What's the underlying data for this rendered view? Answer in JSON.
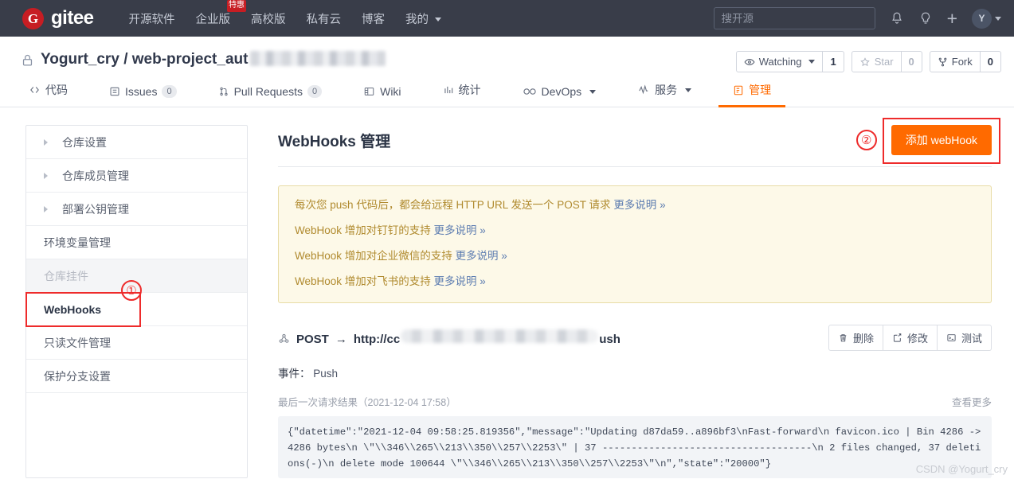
{
  "topnav": {
    "brand": {
      "logo_glyph": "G",
      "name": "gitee"
    },
    "links": [
      {
        "label": "开源软件",
        "badge": ""
      },
      {
        "label": "企业版",
        "badge": "特惠"
      },
      {
        "label": "高校版",
        "badge": ""
      },
      {
        "label": "私有云",
        "badge": ""
      },
      {
        "label": "博客",
        "badge": ""
      },
      {
        "label": "我的",
        "badge": "",
        "has_caret": true
      }
    ],
    "search_placeholder": "搜开源",
    "icons": [
      "bell-icon",
      "lightbulb-icon",
      "plus-icon"
    ],
    "avatar_initial": "Y"
  },
  "repo": {
    "owner": "Yogurt_cry",
    "separator": "/",
    "name_visible": "web-project_aut",
    "watch_label": "Watching",
    "watch_count": "1",
    "star_label": "Star",
    "star_count": "0",
    "fork_label": "Fork",
    "fork_count": "0"
  },
  "tabs": [
    {
      "label": "代码",
      "icon": "code-icon",
      "count": "",
      "active": false
    },
    {
      "label": "Issues",
      "icon": "issue-icon",
      "count": "0",
      "active": false
    },
    {
      "label": "Pull Requests",
      "icon": "pull-request-icon",
      "count": "0",
      "active": false
    },
    {
      "label": "Wiki",
      "icon": "wiki-icon",
      "count": "",
      "active": false
    },
    {
      "label": "统计",
      "icon": "chart-icon",
      "count": "",
      "active": false
    },
    {
      "label": "DevOps",
      "icon": "infinity-icon",
      "count": "",
      "active": false,
      "caret": true
    },
    {
      "label": "服务",
      "icon": "pulse-icon",
      "count": "",
      "active": false,
      "caret": true
    },
    {
      "label": "管理",
      "icon": "manage-icon",
      "count": "",
      "active": true
    }
  ],
  "sidebar": {
    "items": [
      {
        "label": "仓库设置",
        "expandable": true,
        "state": "normal"
      },
      {
        "label": "仓库成员管理",
        "expandable": true,
        "state": "normal"
      },
      {
        "label": "部署公钥管理",
        "expandable": true,
        "state": "normal"
      },
      {
        "label": "环境变量管理",
        "expandable": false,
        "state": "normal"
      },
      {
        "label": "仓库挂件",
        "expandable": false,
        "state": "muted"
      },
      {
        "label": "WebHooks",
        "expandable": false,
        "state": "selected"
      },
      {
        "label": "只读文件管理",
        "expandable": false,
        "state": "normal"
      },
      {
        "label": "保护分支设置",
        "expandable": false,
        "state": "normal"
      }
    ]
  },
  "markers": {
    "one": "①",
    "two": "②"
  },
  "main": {
    "title": "WebHooks 管理",
    "add_button": "添加 webHook",
    "notice": [
      {
        "text": "每次您 push 代码后，都会给远程 HTTP URL 发送一个 POST 请求 ",
        "link": "更多说明 »"
      },
      {
        "text": "WebHook 增加对钉钉的支持 ",
        "link": "更多说明 »"
      },
      {
        "text": "WebHook 增加对企业微信的支持 ",
        "link": "更多说明 »"
      },
      {
        "text": "WebHook 增加对飞书的支持 ",
        "link": "更多说明 »"
      }
    ],
    "hook": {
      "method": "POST",
      "arrow": "→",
      "url_prefix": "http://cc",
      "url_suffix": "ush",
      "actions": [
        {
          "label": "删除",
          "icon": "trash-icon"
        },
        {
          "label": "修改",
          "icon": "edit-icon"
        },
        {
          "label": "测试",
          "icon": "terminal-icon"
        }
      ],
      "event_label": "事件：",
      "event_value": "Push",
      "meta_label": "最后一次请求结果（2021-12-04 17:58）",
      "more_label": "查看更多",
      "log": "{\"datetime\":\"2021-12-04 09:58:25.819356\",\"message\":\"Updating d87da59..a896bf3\\nFast-forward\\n favicon.ico | Bin 4286 -> 4286 bytes\\n \\\"\\\\346\\\\265\\\\213\\\\350\\\\257\\\\2253\\\" | 37 ------------------------------------\\n 2 files changed, 37 deletions(-)\\n delete mode 100644 \\\"\\\\346\\\\265\\\\213\\\\350\\\\257\\\\2253\\\"\\n\",\"state\":\"20000\"}"
    }
  },
  "watermark": "CSDN @Yogurt_cry",
  "colors": {
    "nav_bg": "#393d49",
    "brand_red": "#c71d23",
    "accent_orange": "#ff6a00",
    "notice_bg": "#fdf9e8",
    "notice_border": "#e8dca6",
    "notice_text": "#b08a2e",
    "marker_red": "#ee2b2b"
  }
}
